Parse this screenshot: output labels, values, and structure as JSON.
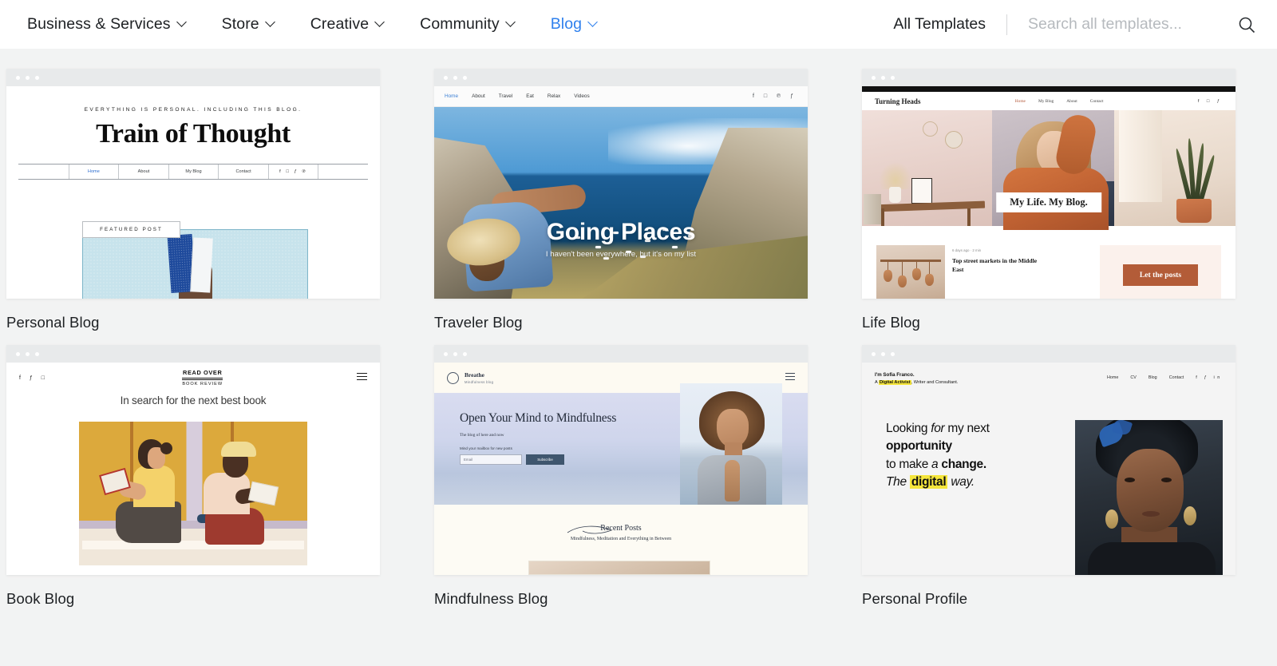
{
  "header": {
    "nav": [
      {
        "label": "Business & Services",
        "has_chevron": true,
        "active": false
      },
      {
        "label": "Store",
        "has_chevron": true,
        "active": false
      },
      {
        "label": "Creative",
        "has_chevron": true,
        "active": false
      },
      {
        "label": "Community",
        "has_chevron": true,
        "active": false
      },
      {
        "label": "Blog",
        "has_chevron": true,
        "active": true
      }
    ],
    "all_templates": "All Templates",
    "search_placeholder": "Search all templates...",
    "search_value": "",
    "search_icon": "search-icon",
    "accent_color": "#2f80ed"
  },
  "cards": [
    {
      "label": "Personal Blog",
      "preview": {
        "tagline": "EVERYTHING IS PERSONAL. INCLUDING THIS BLOG.",
        "title": "Train of Thought",
        "nav": [
          "Home",
          "About",
          "My Blog",
          "Contact"
        ],
        "socials": "f □ ƒ ℗",
        "featured_label": "FEATURED POST"
      }
    },
    {
      "label": "Traveler Blog",
      "preview": {
        "nav": [
          "Home",
          "About",
          "Travel",
          "Eat",
          "Relax",
          "Videos"
        ],
        "socials": "f □ ℗ ƒ",
        "headline": "Going Places",
        "subhead": "I haven't been everywhere, but it's on my list"
      }
    },
    {
      "label": "Life Blog",
      "preview": {
        "logo": "Turning Heads",
        "nav": [
          "Home",
          "My Blog",
          "About",
          "Contact"
        ],
        "socials": "f □ ƒ",
        "banner": "My Life. My Blog.",
        "post_meta": "6 days ago · 2 min",
        "post_title": "Top street markets in the Middle East",
        "cta": "Let the posts",
        "accent_color": "#b35c38"
      }
    },
    {
      "label": "Book Blog",
      "preview": {
        "socials": "f ƒ □",
        "logo_line1": "READ OVER",
        "logo_line2": "BOOK REVIEW",
        "headline": "In search for the next best book"
      }
    },
    {
      "label": "Mindfulness Blog",
      "preview": {
        "logo": "Breathe",
        "logo_sub": "Mindfulness blog",
        "headline": "Open Your Mind to Mindfulness",
        "subhead": "The blog of here and now",
        "form_label": "Mind your mailbox for new posts",
        "email_placeholder": "Email",
        "subscribe_label": "Subscribe",
        "recent_title": "Recent Posts",
        "recent_sub": "Mindfulness, Meditation and Everything in Between"
      }
    },
    {
      "label": "Personal Profile",
      "preview": {
        "name": "I'm Sofia Franco.",
        "role_prefix": "A ",
        "role_highlight": "Digital Activist",
        "role_suffix": ", Writer and Consultant.",
        "nav": [
          "Home",
          "CV",
          "Blog",
          "Contact"
        ],
        "socials": "f ƒ in",
        "headline_parts": [
          {
            "text": "Looking ",
            "style": "normal"
          },
          {
            "text": "for",
            "style": "italic"
          },
          {
            "text": " my next",
            "style": "normal"
          },
          {
            "text": "opportunity",
            "style": "bold"
          },
          {
            "text": "to make ",
            "style": "normal"
          },
          {
            "text": "a ",
            "style": "italic"
          },
          {
            "text": "change.",
            "style": "bold"
          },
          {
            "text": "The ",
            "style": "italic"
          },
          {
            "text": "digital",
            "style": "highlight"
          },
          {
            "text": " way.",
            "style": "italic"
          }
        ],
        "highlight_color": "#f5e63c"
      }
    }
  ]
}
